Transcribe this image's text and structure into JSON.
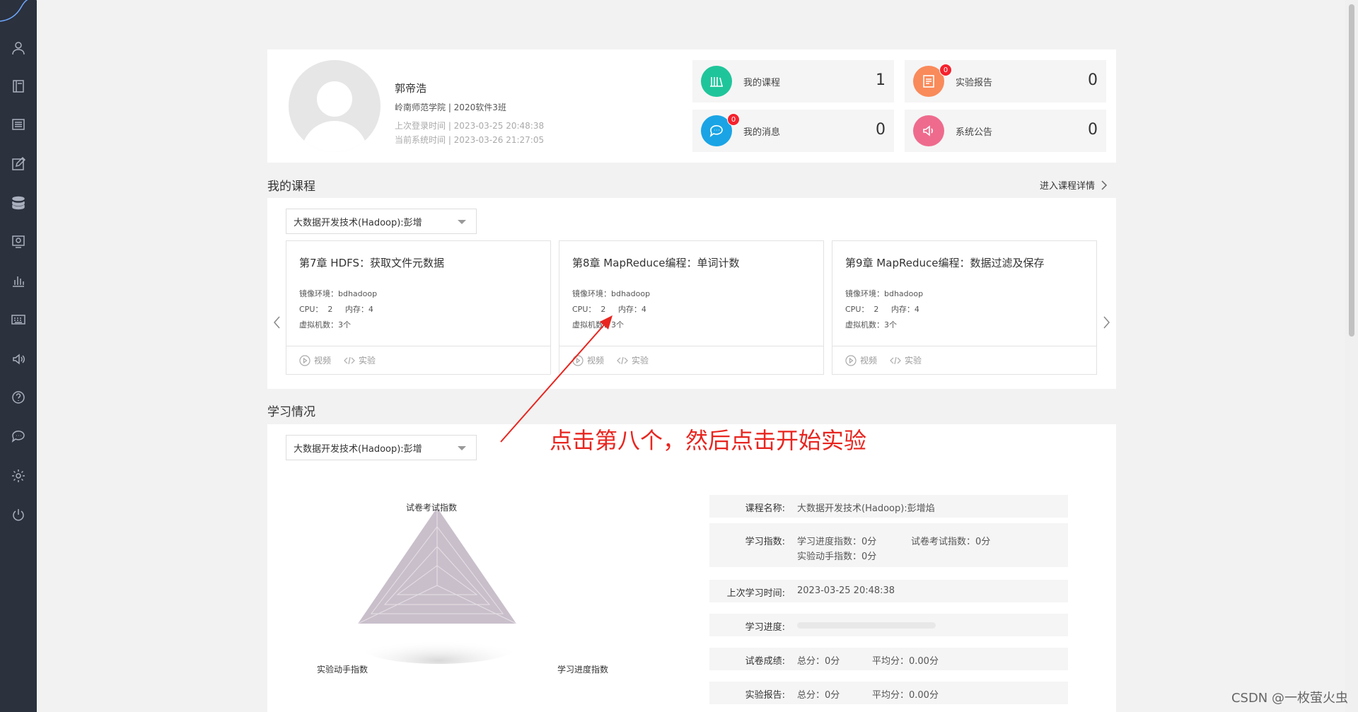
{
  "profile": {
    "name": "郭帝浩",
    "school": "岭南师范学院 | 2020软件3班",
    "last_login": "上次登录时间 | 2023-03-25 20:48:38",
    "system_time": "当前系统时间 | 2023-03-26 21:27:05"
  },
  "stats": [
    {
      "label": "我的课程",
      "count": "1",
      "color": "#1fc59a",
      "icon": "books-icon",
      "badge": ""
    },
    {
      "label": "实验报告",
      "count": "0",
      "color": "#f98a5a",
      "icon": "report-icon",
      "badge": "0"
    },
    {
      "label": "我的消息",
      "count": "0",
      "color": "#1aa4e5",
      "icon": "chat-icon",
      "badge": "0"
    },
    {
      "label": "系统公告",
      "count": "0",
      "color": "#ee6b8d",
      "icon": "speaker-icon",
      "badge": ""
    }
  ],
  "my_courses": {
    "title": "我的课程",
    "detail_link": "进入课程详情",
    "selected_course": "大数据开发技术(Hadoop):彭增",
    "cards": [
      {
        "title": "第7章 HDFS：获取文件元数据",
        "image": "镜像环境：bdhadoop",
        "cpu": "CPU：  2     内存：4",
        "vms": "虚拟机数：3个",
        "video": "视频",
        "lab": "实验"
      },
      {
        "title": "第8章 MapReduce编程：单词计数",
        "image": "镜像环境：bdhadoop",
        "cpu": "CPU：  2     内存：4",
        "vms": "虚拟机数：3个",
        "video": "视频",
        "lab": "实验"
      },
      {
        "title": "第9章 MapReduce编程：数据过滤及保存",
        "image": "镜像环境：bdhadoop",
        "cpu": "CPU：  2     内存：4",
        "vms": "虚拟机数：3个",
        "video": "视频",
        "lab": "实验"
      }
    ]
  },
  "study": {
    "title": "学习情况",
    "selected_course": "大数据开发技术(Hadoop):彭增",
    "radar": {
      "top_label": "试卷考试指数",
      "left_label": "实验动手指数",
      "right_label": "学习进度指数"
    },
    "info": {
      "course_name_key": "课程名称:",
      "course_name_val": "大数据开发技术(Hadoop):彭增焰",
      "index_key": "学习指数:",
      "index_progress": "学习进度指数：0分",
      "index_exam": "试卷考试指数：0分",
      "index_lab": "实验动手指数：0分",
      "last_study_key": "上次学习时间:",
      "last_study_val": "2023-03-25 20:48:38",
      "progress_key": "学习进度:",
      "progress_value": 0,
      "exam_key": "试卷成绩:",
      "exam_total": "总分：0分",
      "exam_avg": "平均分：0.00分",
      "report_key": "实验报告:",
      "report_total": "总分：0分",
      "report_avg": "平均分：0.00分"
    }
  },
  "annotation": "点击第八个，然后点击开始实验",
  "watermark": "CSDN @一枚萤火虫",
  "colors": {
    "annotation": "#e8251f",
    "sidebar": "#2b313d",
    "radar": "#c9bfcb"
  }
}
